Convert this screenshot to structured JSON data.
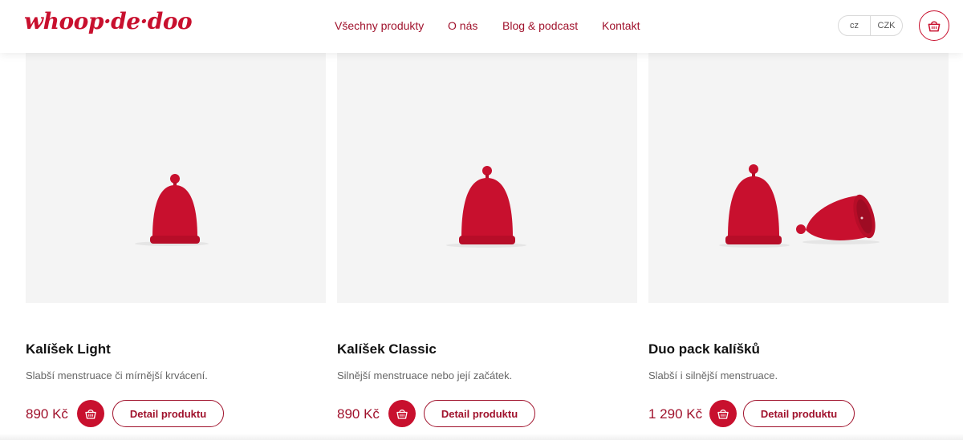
{
  "header": {
    "logo_text": "whoop·de·doo",
    "nav": [
      "Všechny produkty",
      "O nás",
      "Blog & podcast",
      "Kontakt"
    ],
    "language": "cz",
    "currency": "CZK",
    "cart_icon": "basket-icon"
  },
  "colors": {
    "brand": "#c8102e",
    "brand_dark": "#a0122c",
    "image_bg": "#f4f4f4"
  },
  "products": [
    {
      "name": "Kalíšek Light",
      "description": "Slabší menstruace či mírnější krvácení.",
      "price": "890 Kč",
      "detail_label": "Detail produktu",
      "image": "single-cup"
    },
    {
      "name": "Kalíšek Classic",
      "description": "Silnější menstruace nebo její začátek.",
      "price": "890 Kč",
      "detail_label": "Detail produktu",
      "image": "single-cup"
    },
    {
      "name": "Duo pack kalíšků",
      "description": "Slabší i silnější menstruace.",
      "price": "1 290 Kč",
      "detail_label": "Detail produktu",
      "image": "two-cups"
    }
  ]
}
